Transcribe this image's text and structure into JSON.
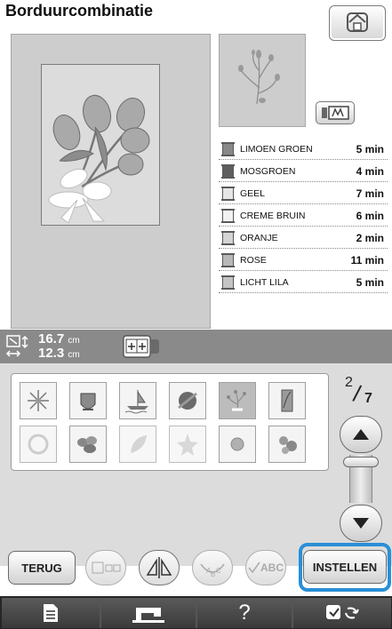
{
  "title": "Borduurcombinatie",
  "icons": {
    "home": "home-icon",
    "thread_display": "thread-display-icon",
    "size": "size-arrows-icon",
    "combine": "combine-pattern-icon",
    "scroll_up": "triangle-up-icon",
    "scroll_down": "triangle-down-icon",
    "mirror": "mirror-icon",
    "arc": "arc-text-icon",
    "check_abc": "check-abc-icon",
    "notes": "notes-icon",
    "sewing": "sewing-machine-icon",
    "help": "question-icon",
    "settings": "settings-icon"
  },
  "colors": [
    {
      "name": "LIMOEN GROEN",
      "time": "5 min",
      "swatch": "#888888"
    },
    {
      "name": "MOSGROEN",
      "time": "4 min",
      "swatch": "#5e5e5e"
    },
    {
      "name": "GEEL",
      "time": "7 min",
      "swatch": "#e6e6e6"
    },
    {
      "name": "CREME BRUIN",
      "time": "6 min",
      "swatch": "#f2f2f2"
    },
    {
      "name": "ORANJE",
      "time": "2 min",
      "swatch": "#d4d4d4"
    },
    {
      "name": "ROSE",
      "time": "11 min",
      "swatch": "#b8b8b8"
    },
    {
      "name": "LICHT LILA",
      "time": "5 min",
      "swatch": "#c4c4c4"
    }
  ],
  "dimensions": {
    "height_value": "16.7",
    "width_value": "12.3",
    "unit": "cm"
  },
  "pager": {
    "current": "2",
    "total": "7"
  },
  "buttons": {
    "back": "TERUG",
    "set": "INSTELLEN",
    "check_abc": "ABC",
    "help": "?"
  },
  "accent_color": "#2a8fd6"
}
